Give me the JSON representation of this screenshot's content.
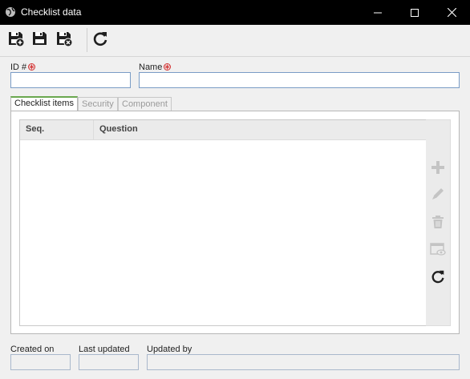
{
  "window": {
    "title": "Checklist data",
    "icons": {
      "app": "globe-icon",
      "minimize": "minimize-icon",
      "maximize": "maximize-icon",
      "close": "close-icon"
    }
  },
  "toolbar": {
    "buttons": [
      "save-new-icon",
      "save-icon",
      "save-close-icon",
      "refresh-icon"
    ]
  },
  "form": {
    "id_label": "ID #",
    "id_value": "",
    "name_label": "Name",
    "name_value": "",
    "required_icon": "required-asterisk-icon"
  },
  "tabs": [
    {
      "label": "Checklist items",
      "active": true
    },
    {
      "label": "Security",
      "active": false
    },
    {
      "label": "Component",
      "active": false
    }
  ],
  "grid": {
    "columns": [
      "Seq.",
      "Question"
    ],
    "rows": []
  },
  "side_buttons": [
    "add-icon",
    "edit-icon",
    "delete-icon",
    "view-icon",
    "refresh-icon"
  ],
  "footer": {
    "created_on_label": "Created on",
    "created_on_value": "",
    "last_updated_label": "Last updated",
    "last_updated_value": "",
    "updated_by_label": "Updated by",
    "updated_by_value": ""
  },
  "colors": {
    "titlebar": "#000000",
    "tab_accent": "#6aa84f",
    "required": "#d32f2f",
    "field_border": "#7a9cc6"
  }
}
